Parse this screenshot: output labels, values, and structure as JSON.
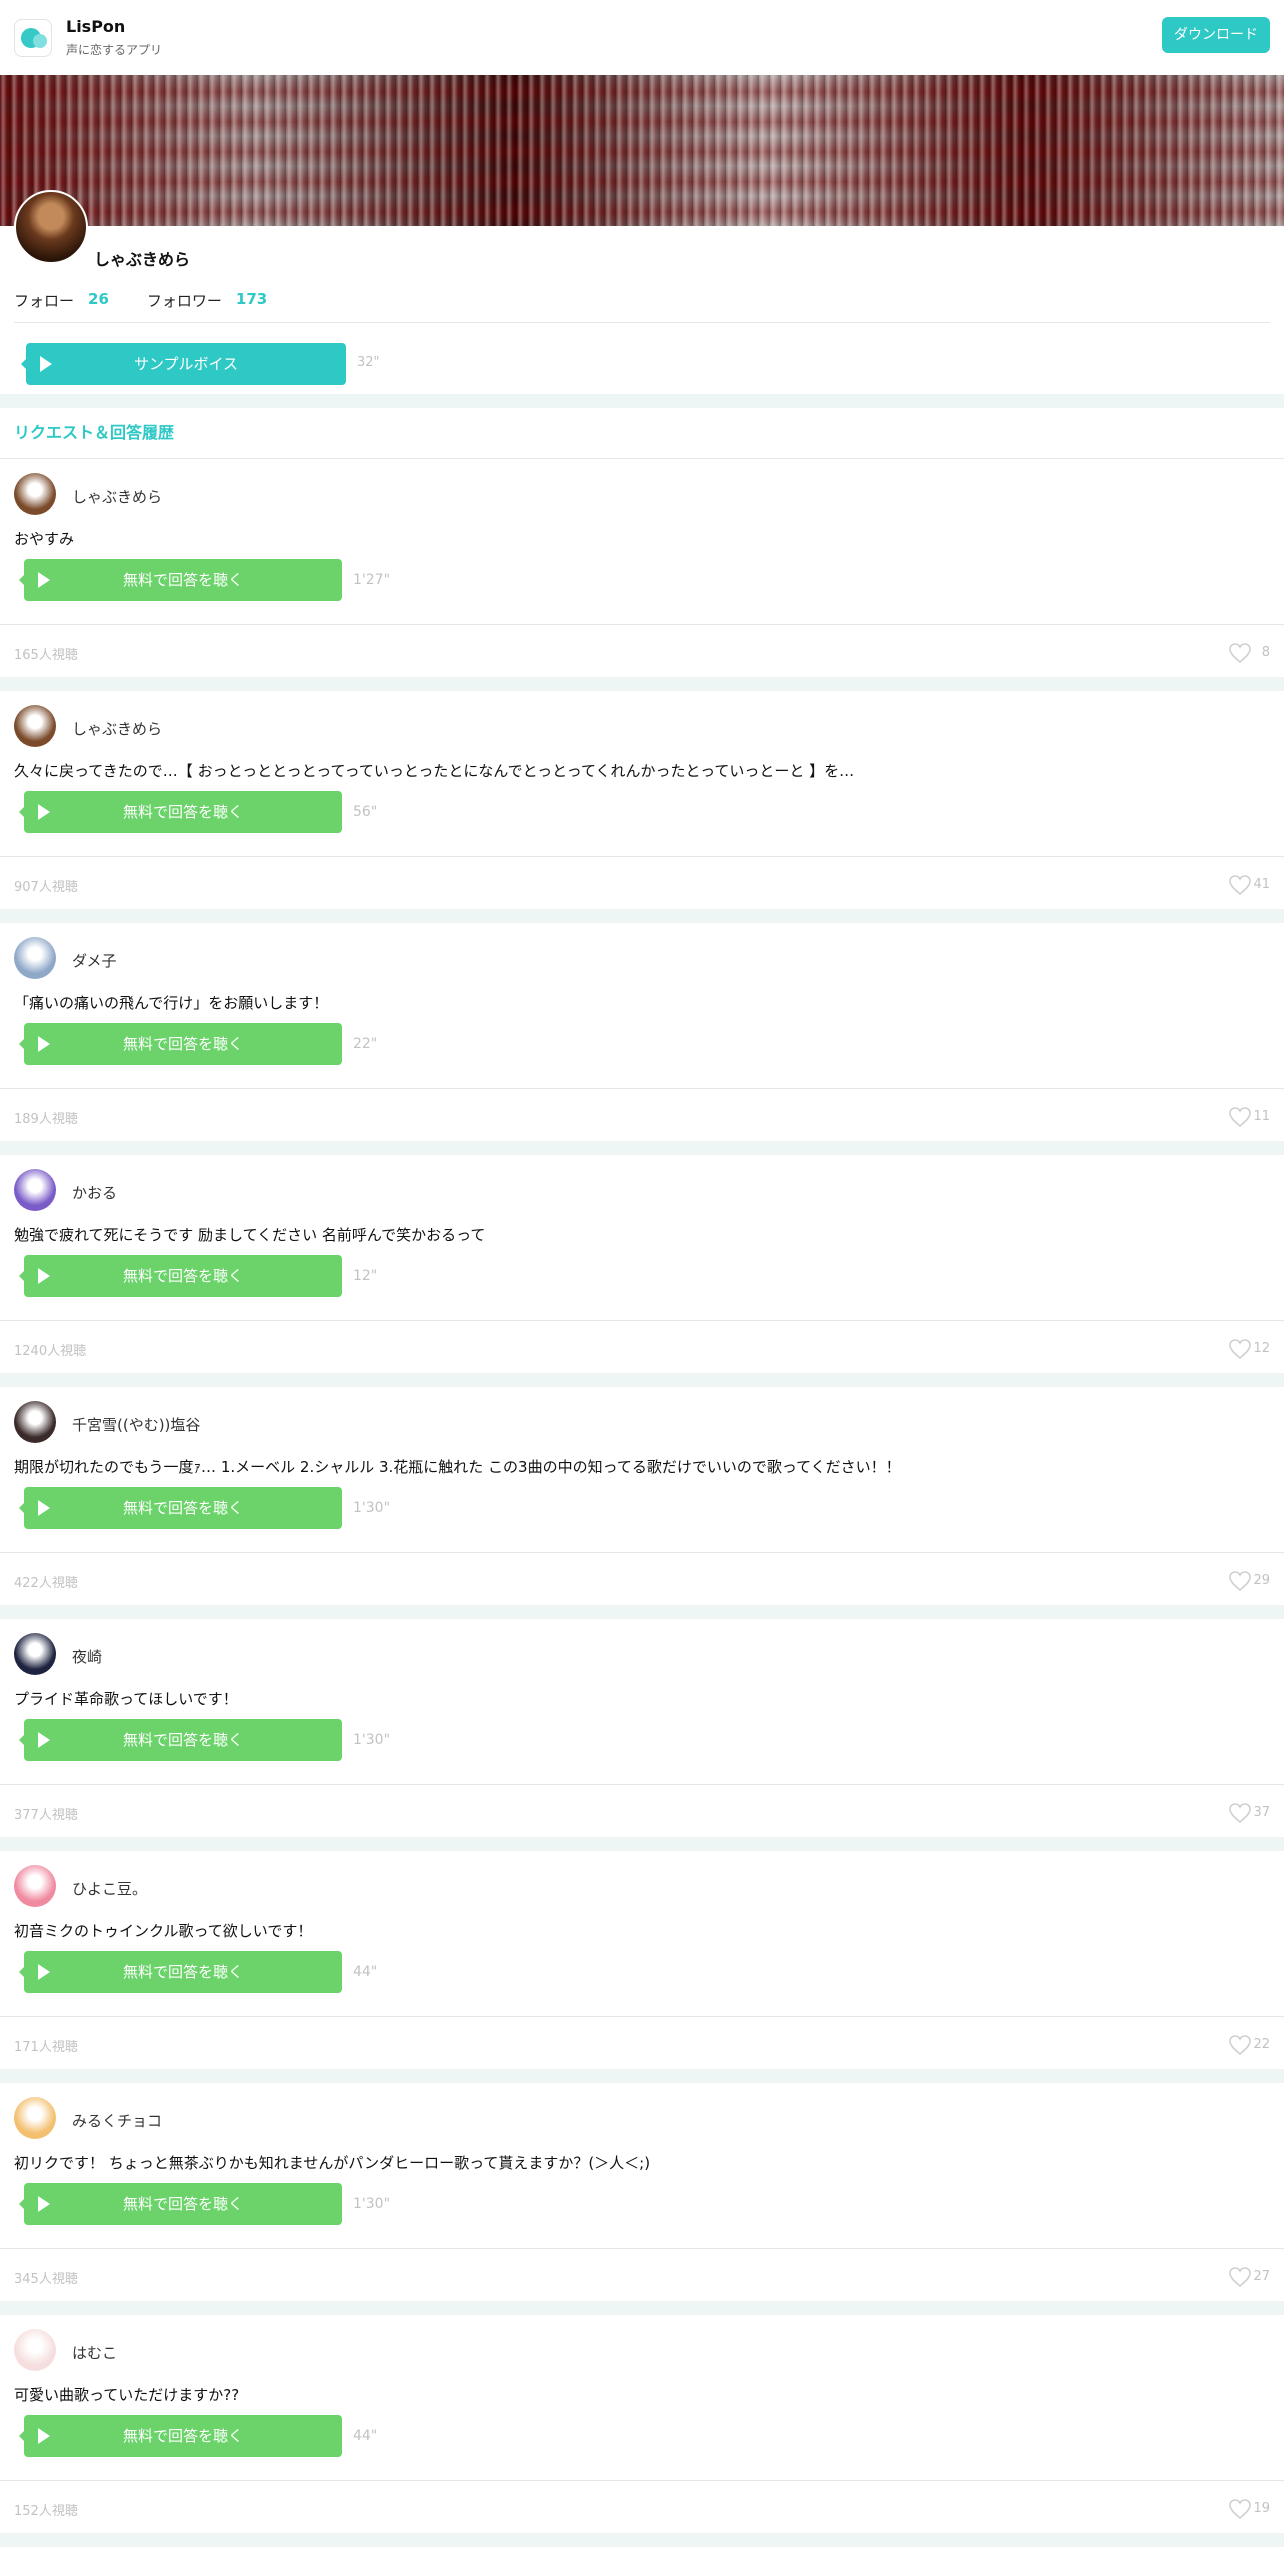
{
  "app": {
    "name": "LisPon",
    "tagline": "声に恋するアプリ",
    "download_label": "ダウンロード",
    "accent": "#2ec8c5"
  },
  "profile": {
    "name": "しゃぶきめら",
    "follow_label": "フォロー",
    "follow_count": "26",
    "follower_label": "フォロワー",
    "follower_count": "173",
    "sample_label": "サンプルボイス",
    "sample_duration": "32\""
  },
  "section_title": "リクエスト＆回答履歴",
  "listen_label": "無料で回答を聴く",
  "requests": [
    {
      "user": "しゃぶきめら",
      "text": "おやすみ",
      "duration": "1'27\"",
      "views": "165人視聴",
      "likes": "8",
      "avatar_color": "#7a4a2a"
    },
    {
      "user": "しゃぶきめら",
      "text": "久々に戻ってきたので…【 おっとっととっとってっていっとったとになんでとっとってくれんかったとっていっとーと 】を…",
      "duration": "56\"",
      "views": "907人視聴",
      "likes": "41",
      "avatar_color": "#7a4a2a"
    },
    {
      "user": "ダメ子",
      "text": "「痛いの痛いの飛んで行け」をお願いします！",
      "duration": "22\"",
      "views": "189人視聴",
      "likes": "11",
      "avatar_color": "#8fa8c8"
    },
    {
      "user": "かおる",
      "text": "勉強で疲れて死にそうです 励ましてください 名前呼んで笑かおるって",
      "duration": "12\"",
      "views": "1240人視聴",
      "likes": "12",
      "avatar_color": "#7a5bc8"
    },
    {
      "user": "千宮雪((やむ))塩谷",
      "text": "期限が切れたのでもう一度ｧ… 1.メーベル 2.シャルル 3.花瓶に触れた この3曲の中の知ってる歌だけでいいので歌ってください！！",
      "duration": "1'30\"",
      "views": "422人視聴",
      "likes": "29",
      "avatar_color": "#3a2a2a"
    },
    {
      "user": "夜崎",
      "text": "プライド革命歌ってほしいです！",
      "duration": "1'30\"",
      "views": "377人視聴",
      "likes": "37",
      "avatar_color": "#1e2440"
    },
    {
      "user": "ひよこ豆。",
      "text": "初音ミクのトゥインクル歌って欲しいです！",
      "duration": "44\"",
      "views": "171人視聴",
      "likes": "22",
      "avatar_color": "#f08aa0"
    },
    {
      "user": "みるくチョコ",
      "text": "初リクです！ ちょっと無茶ぶりかも知れませんがパンダヒーロー歌って貰えますか？(＞人＜;)",
      "duration": "1'30\"",
      "views": "345人視聴",
      "likes": "27",
      "avatar_color": "#f3c070"
    },
    {
      "user": "はむこ",
      "text": "可愛い曲歌っていただけますか??",
      "duration": "44\"",
      "views": "152人視聴",
      "likes": "19",
      "avatar_color": "#f6dede"
    }
  ]
}
